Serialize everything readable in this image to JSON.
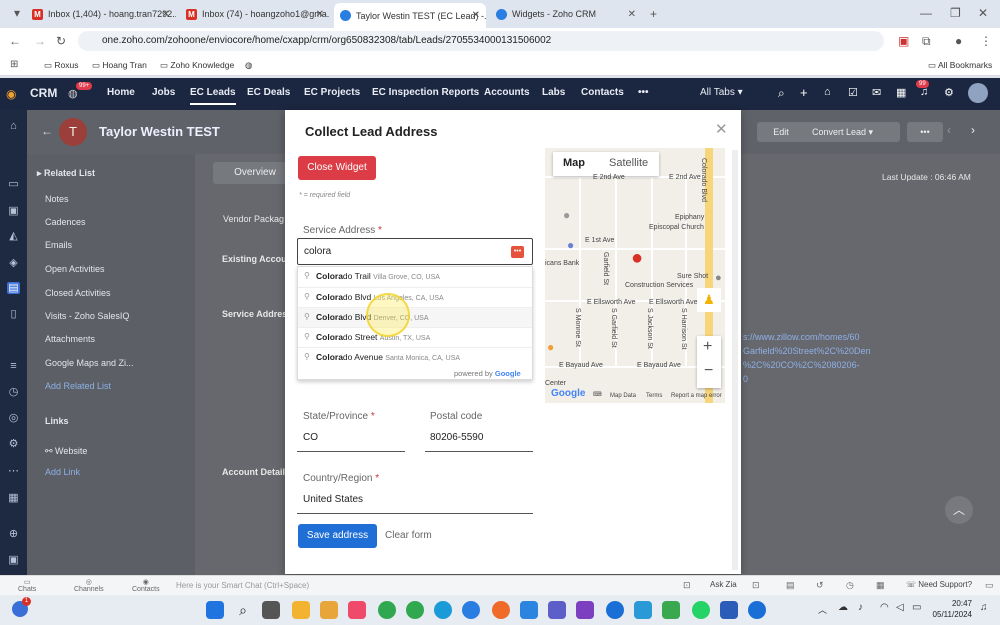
{
  "browser": {
    "tabs": [
      {
        "label": "Inbox (1,404) - hoang.tran7292..."
      },
      {
        "label": "Inbox (74) - hoangzoho1@gma..."
      },
      {
        "label": "Taylor Westin TEST (EC Lead) -..."
      },
      {
        "label": "Widgets - Zoho CRM"
      }
    ],
    "url": "one.zoho.com/zohoone/enviocore/home/cxapp/crm/org650832308/tab/Leads/2705534000131506002",
    "bookmarks": [
      "Roxus",
      "Hoang Tran",
      "Zoho Knowledge"
    ],
    "all_bookmarks": "All Bookmarks"
  },
  "crm": {
    "brand": "CRM",
    "badge": "99+",
    "nav": [
      "Home",
      "Jobs",
      "EC Leads",
      "EC Deals",
      "EC Projects",
      "EC Inspection Reports",
      "Accounts",
      "Labs",
      "Contacts"
    ],
    "more": "•••",
    "all_tabs": "All Tabs",
    "notif_badge": "99",
    "record_title": "Taylor Westin TEST",
    "avatar_letter": "T",
    "edit": "Edit",
    "convert_lead": "Convert Lead",
    "overview_tab": "Overview",
    "last_update": "Last Update : 06:46 AM",
    "related_list_title": "Related List",
    "related_items": [
      "Notes",
      "Cadences",
      "Emails",
      "Open Activities",
      "Closed Activities",
      "Visits - Zoho SalesIQ",
      "Attachments",
      "Google Maps and Zi..."
    ],
    "add_related_list": "Add Related List",
    "links_title": "Links",
    "website": "Website",
    "add_link": "Add Link",
    "section_labels": [
      "Vendor Packag",
      "Existing Accou",
      "Service Addres",
      "Account Detail"
    ],
    "zillow_lines": [
      "s://www.zillow.com/homes/60",
      "Garfield%20Street%2C%20Den",
      "%2C%20CO%2C%2080206-",
      "0"
    ]
  },
  "modal": {
    "title": "Collect Lead Address",
    "close_widget": "Close Widget",
    "required_note": "* = required field",
    "service_address_label": "Service Address",
    "service_address_value": "colora",
    "suggestions": [
      {
        "match": "Colora",
        "rest": "do Trail",
        "sub": "Villa Grove, CO, USA"
      },
      {
        "match": "Colora",
        "rest": "do Blvd",
        "sub": "Los Angeles, CA, USA"
      },
      {
        "match": "Colora",
        "rest": "do Blvd",
        "sub": "Denver, CO, USA"
      },
      {
        "match": "Colora",
        "rest": "do Street",
        "sub": "Austin, TX, USA"
      },
      {
        "match": "Colora",
        "rest": "do Avenue",
        "sub": "Santa Monica, CA, USA"
      }
    ],
    "powered_by": "powered by",
    "google": "Google",
    "state_label": "State/Province",
    "state_value": "CO",
    "postal_label": "Postal code",
    "postal_value": "80206-5590",
    "country_label": "Country/Region",
    "country_value": "United States",
    "save": "Save address",
    "clear": "Clear form"
  },
  "map": {
    "tab_map": "Map",
    "tab_satellite": "Satellite",
    "streets": [
      "Colorado Blvd",
      "E 2nd Ave",
      "E 2nd Ave",
      "E 1st Ave",
      "Epiphany",
      "Episcopal Church",
      "Garfield St",
      "icans Bank",
      "Sure Shot",
      "Construction Services",
      "E Ellsworth Ave",
      "E Ellsworth Ave",
      "S Monroe St",
      "S Garfield St",
      "S Jackson St",
      "S Harrison St",
      "E Bayaud Ave",
      "E Bayaud Ave",
      "Center"
    ],
    "footer": [
      "Map Data",
      "Terms",
      "Report a map error"
    ],
    "google": "Google"
  },
  "smartchat": {
    "placeholder": "Here is your Smart Chat (Ctrl+Space)",
    "items": [
      "Chats",
      "Channels",
      "Contacts"
    ],
    "ask_zia": "Ask Zia",
    "need_support": "Need Support?"
  },
  "taskbar": {
    "time": "20:47",
    "date": "05/11/2024",
    "notif": "1"
  }
}
